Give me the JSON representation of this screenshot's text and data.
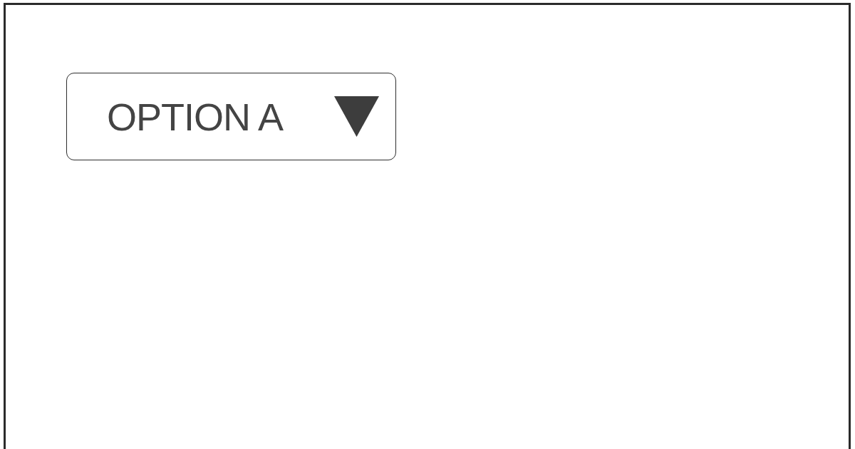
{
  "dropdown": {
    "value": "OPTION A"
  }
}
